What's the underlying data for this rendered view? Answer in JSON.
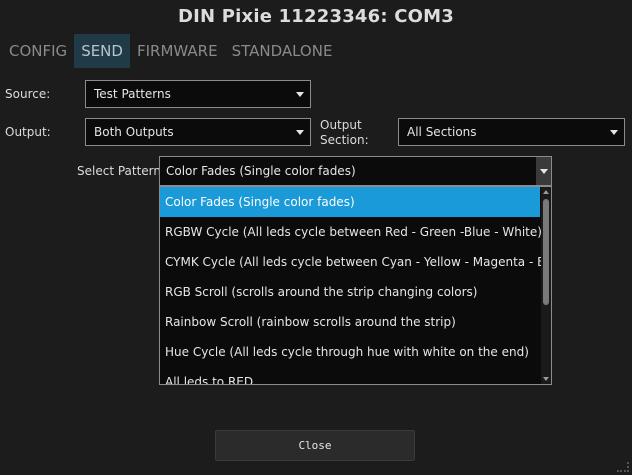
{
  "window": {
    "title": "DIN Pixie 11223346: COM3"
  },
  "tabs": [
    {
      "label": "CONFIG",
      "active": false
    },
    {
      "label": "SEND",
      "active": true
    },
    {
      "label": "FIRMWARE",
      "active": false
    },
    {
      "label": "STANDALONE",
      "active": false
    }
  ],
  "form": {
    "source": {
      "label": "Source:",
      "value": "Test Patterns"
    },
    "output": {
      "label": "Output:",
      "value": "Both Outputs"
    },
    "output_section": {
      "label_line1": "Output",
      "label_line2": "Section:",
      "value": "All Sections"
    },
    "pattern": {
      "label": "Select Pattern:",
      "value": "Color Fades (Single color fades)"
    }
  },
  "pattern_options": [
    "Color Fades (Single color fades)",
    "RGBW Cycle (All leds cycle between Red - Green -Blue - White)",
    "CYMK Cycle (All leds cycle between Cyan - Yellow - Magenta - Black)",
    "RGB Scroll (scrolls around the strip changing colors)",
    "Rainbow Scroll (rainbow scrolls around the strip)",
    "Hue Cycle (All leds cycle through hue with white on the end)",
    "All leds to RED"
  ],
  "buttons": {
    "close": "Close"
  },
  "colors": {
    "accent": "#1a9ad8",
    "tab_active_bg": "#203a48",
    "background": "#1c1c1c"
  }
}
